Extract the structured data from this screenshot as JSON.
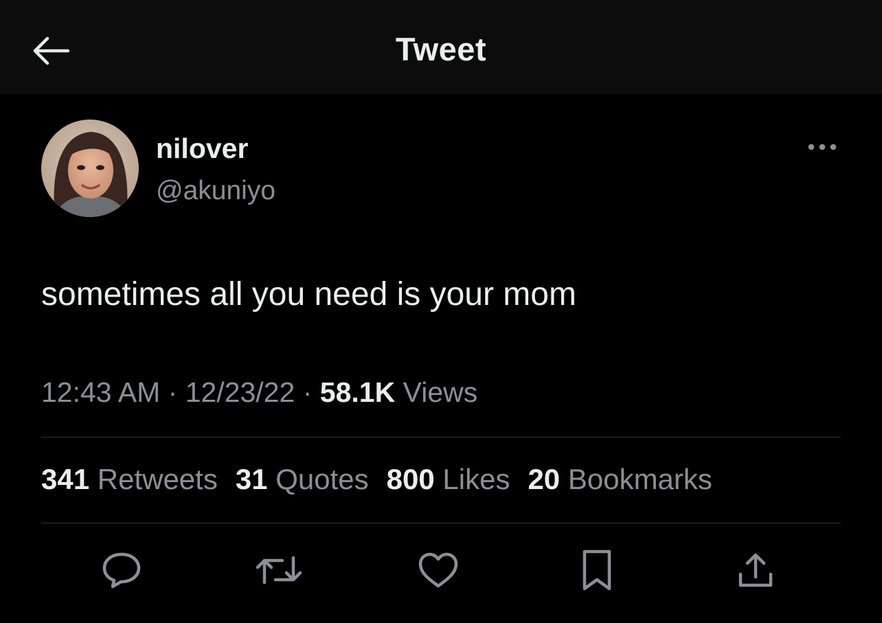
{
  "header": {
    "title": "Tweet",
    "back_icon": "arrow-left-icon"
  },
  "author": {
    "display_name": "nilover",
    "handle": "@akuniyo",
    "avatar_icon": "user-avatar"
  },
  "tweet": {
    "text": "sometimes all you need is your mom",
    "time": "12:43 AM",
    "date": "12/23/22",
    "views_count": "58.1K",
    "views_label": "Views",
    "separator": "·"
  },
  "stats": [
    {
      "count": "341",
      "label": "Retweets"
    },
    {
      "count": "31",
      "label": "Quotes"
    },
    {
      "count": "800",
      "label": "Likes"
    },
    {
      "count": "20",
      "label": "Bookmarks"
    }
  ],
  "actions": [
    "reply-icon",
    "retweet-icon",
    "like-icon",
    "bookmark-icon",
    "share-icon"
  ],
  "colors": {
    "background": "#000000",
    "header_background": "#0c0c0c",
    "primary_text": "#eceded",
    "secondary_text": "#8b9096",
    "divider": "#2f3336"
  }
}
